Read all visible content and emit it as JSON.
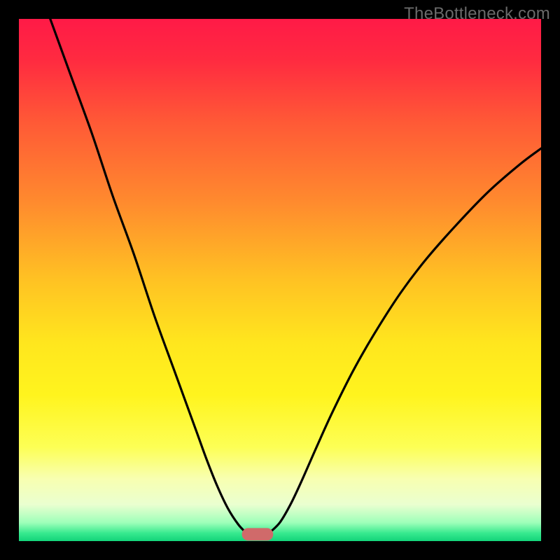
{
  "watermark": "TheBottleneck.com",
  "chart_data": {
    "type": "line",
    "title": "",
    "xlabel": "",
    "ylabel": "",
    "xlim": [
      0,
      100
    ],
    "ylim": [
      0,
      100
    ],
    "grid": false,
    "background_gradient_stops": [
      {
        "offset": 0.0,
        "color": "#ff1a47"
      },
      {
        "offset": 0.08,
        "color": "#ff2b40"
      },
      {
        "offset": 0.2,
        "color": "#ff5a36"
      },
      {
        "offset": 0.35,
        "color": "#ff8a2e"
      },
      {
        "offset": 0.5,
        "color": "#ffc223"
      },
      {
        "offset": 0.62,
        "color": "#ffe61e"
      },
      {
        "offset": 0.72,
        "color": "#fff41e"
      },
      {
        "offset": 0.82,
        "color": "#fdff55"
      },
      {
        "offset": 0.88,
        "color": "#f8ffb0"
      },
      {
        "offset": 0.93,
        "color": "#eaffd0"
      },
      {
        "offset": 0.965,
        "color": "#9dffb9"
      },
      {
        "offset": 0.985,
        "color": "#36e98e"
      },
      {
        "offset": 1.0,
        "color": "#13d47a"
      }
    ],
    "series": [
      {
        "name": "left-arm",
        "color": "#000000",
        "x": [
          6,
          10,
          14,
          18,
          22,
          26,
          30,
          34,
          36,
          38,
          40,
          42,
          43.5
        ],
        "y": [
          100,
          89,
          78,
          66,
          55,
          43,
          32,
          21,
          15.5,
          10.5,
          6.3,
          3.2,
          1.6
        ]
      },
      {
        "name": "right-arm",
        "color": "#000000",
        "x": [
          48,
          50,
          52,
          54,
          57,
          60,
          64,
          68,
          73,
          78,
          84,
          90,
          96,
          100
        ],
        "y": [
          1.6,
          3.6,
          7.0,
          11.2,
          18.0,
          24.6,
          32.6,
          39.6,
          47.4,
          54.0,
          60.8,
          67.0,
          72.2,
          75.2
        ]
      }
    ],
    "marker": {
      "name": "min-bar",
      "color": "#d06a6a",
      "x_center": 45.7,
      "y_center": 1.3,
      "width": 6.0,
      "height": 2.4,
      "rx": 1.2
    }
  }
}
